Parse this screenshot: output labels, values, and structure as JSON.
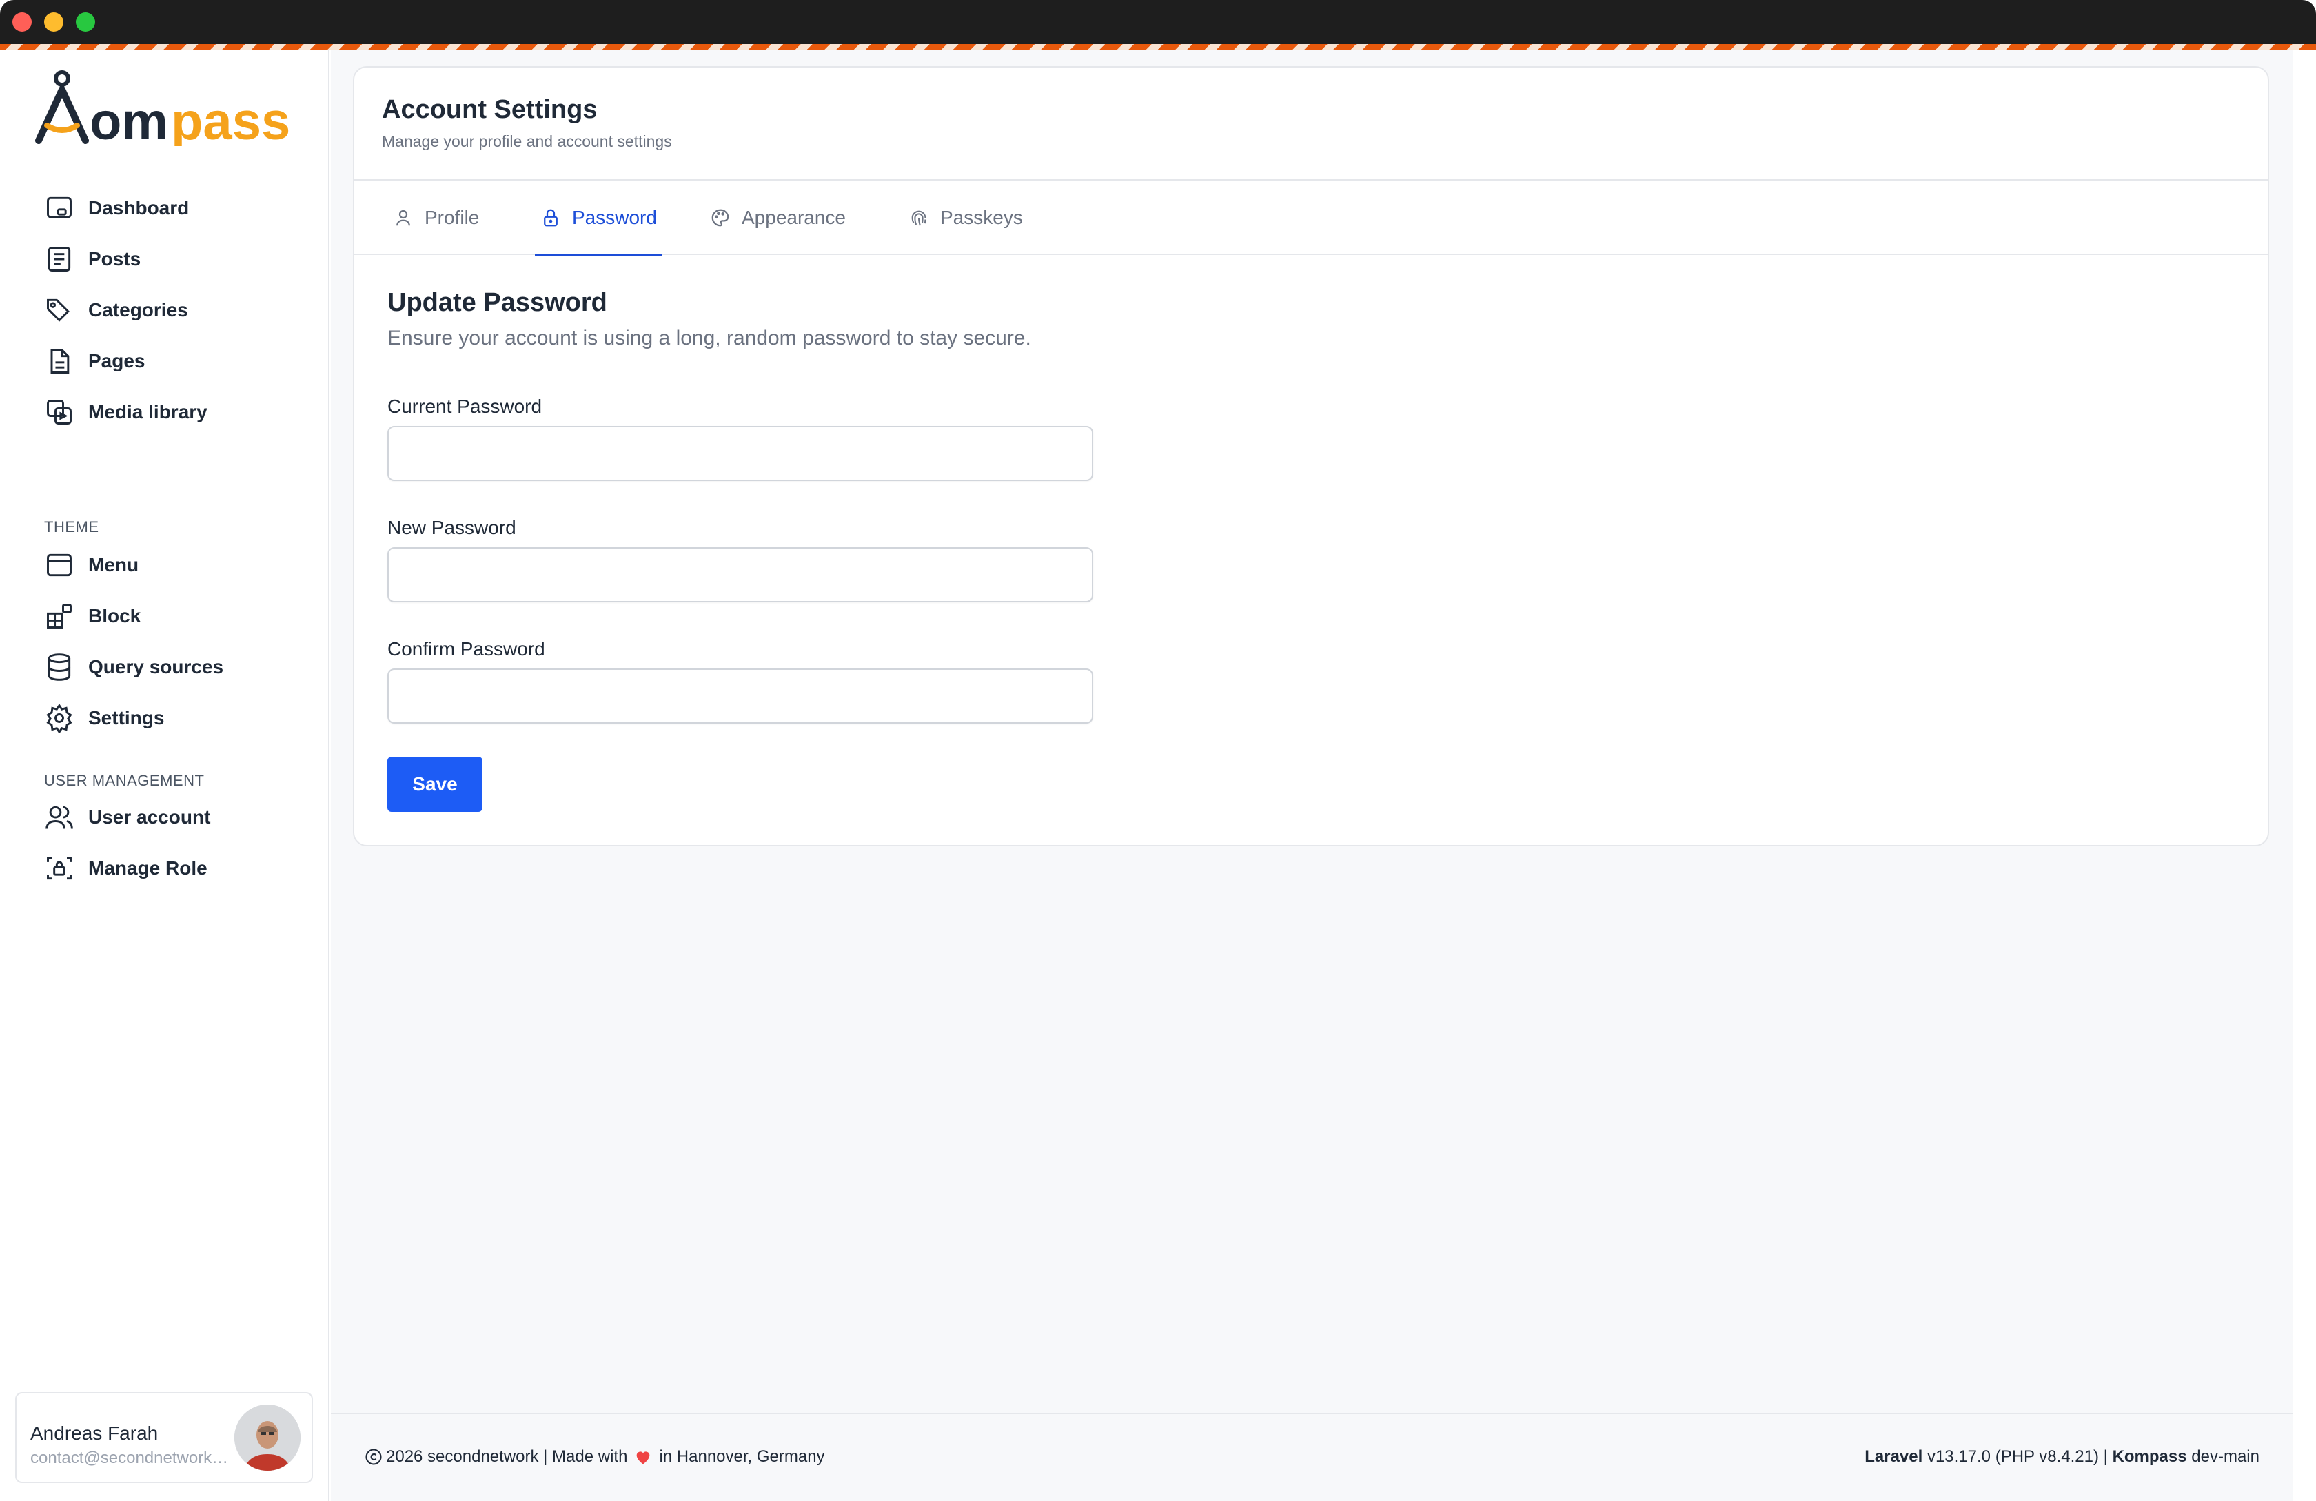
{
  "brand": {
    "logo_text": "Kompass",
    "accent": "#f5a21b",
    "dark": "#1f2937",
    "stripe_color": "#e8590c"
  },
  "sidebar": {
    "items": [
      {
        "label": "Dashboard",
        "icon": "dashboard-icon"
      },
      {
        "label": "Posts",
        "icon": "posts-icon"
      },
      {
        "label": "Categories",
        "icon": "tag-icon"
      },
      {
        "label": "Pages",
        "icon": "page-icon"
      },
      {
        "label": "Media library",
        "icon": "media-icon"
      }
    ],
    "theme_section": "THEME",
    "theme_items": [
      {
        "label": "Menu",
        "icon": "menu-icon"
      },
      {
        "label": "Block",
        "icon": "block-icon"
      },
      {
        "label": "Query sources",
        "icon": "database-icon"
      },
      {
        "label": "Settings",
        "icon": "gear-icon"
      }
    ],
    "user_section": "USER MANAGEMENT",
    "user_items": [
      {
        "label": "User account",
        "icon": "users-icon"
      },
      {
        "label": "Manage Role",
        "icon": "role-icon"
      }
    ]
  },
  "user": {
    "name": "Andreas Farah",
    "email": "contact@secondnetwork.de"
  },
  "header": {
    "title": "Account Settings",
    "subtitle": "Manage your profile and account settings"
  },
  "tabs": [
    {
      "label": "Profile",
      "icon": "user-icon",
      "active": false
    },
    {
      "label": "Password",
      "icon": "lock-icon",
      "active": true
    },
    {
      "label": "Appearance",
      "icon": "palette-icon",
      "active": false
    },
    {
      "label": "Passkeys",
      "icon": "fingerprint-icon",
      "active": false
    }
  ],
  "form": {
    "title": "Update Password",
    "subtitle": "Ensure your account is using a long, random password to stay secure.",
    "fields": [
      {
        "label": "Current Password",
        "value": ""
      },
      {
        "label": "New Password",
        "value": ""
      },
      {
        "label": "Confirm Password",
        "value": ""
      }
    ],
    "save_label": "Save"
  },
  "footer": {
    "left_prefix": "2026 secondnetwork | Made with",
    "left_suffix": "in Hannover, Germany",
    "laravel_label": "Laravel",
    "laravel_version": "v13.17.0 (PHP v8.4.21) |",
    "kompass_label": "Kompass",
    "kompass_version": "dev-main",
    "heart_color": "#ef4444"
  }
}
